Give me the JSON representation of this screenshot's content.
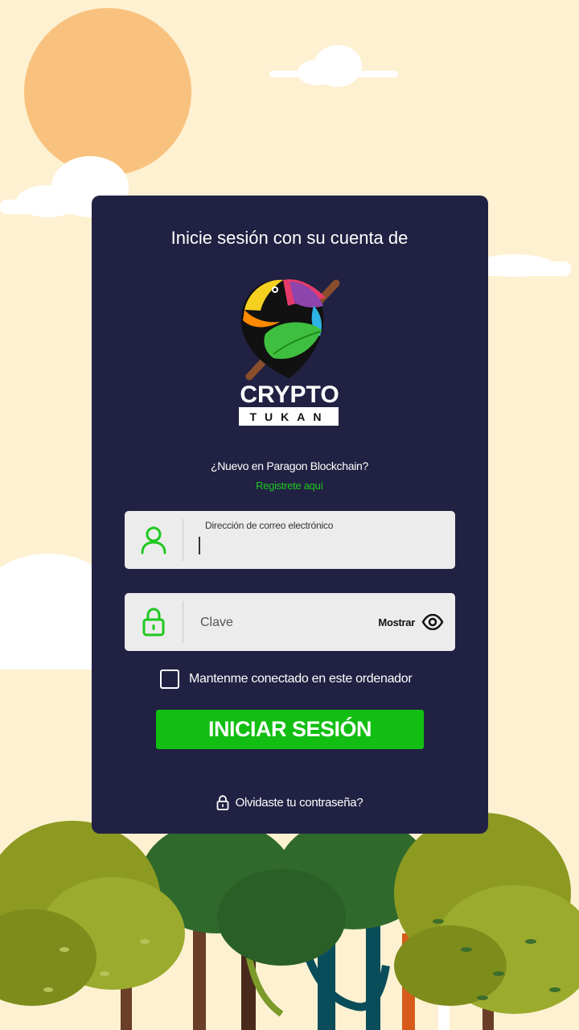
{
  "login": {
    "title": "Inicie sesión con su cuenta de",
    "logo": {
      "brand_top": "CRYPTO",
      "brand_bottom": "TUKAN"
    },
    "new_prompt": "¿Nuevo en Paragon Blockchain?",
    "register_link": "Registrete aquí",
    "email": {
      "label": "Dirección de correo electrónico",
      "value": "",
      "icon": "user-icon"
    },
    "password": {
      "placeholder": "Clave",
      "icon": "lock-icon",
      "show_label": "Mostrar",
      "show_icon": "eye-icon"
    },
    "remember_label": "Mantenme conectado en este ordenador",
    "submit_label": "INICIAR SESIÓN",
    "forgot_label": "Olvidaste tu contraseña?",
    "forgot_icon": "lock-icon"
  },
  "colors": {
    "page_background": "#fdf1d2",
    "card_background": "#212143",
    "accent_green": "#12be12",
    "link_green": "#1ec81e",
    "field_background": "#ececec",
    "sun": "#f8c27e"
  }
}
